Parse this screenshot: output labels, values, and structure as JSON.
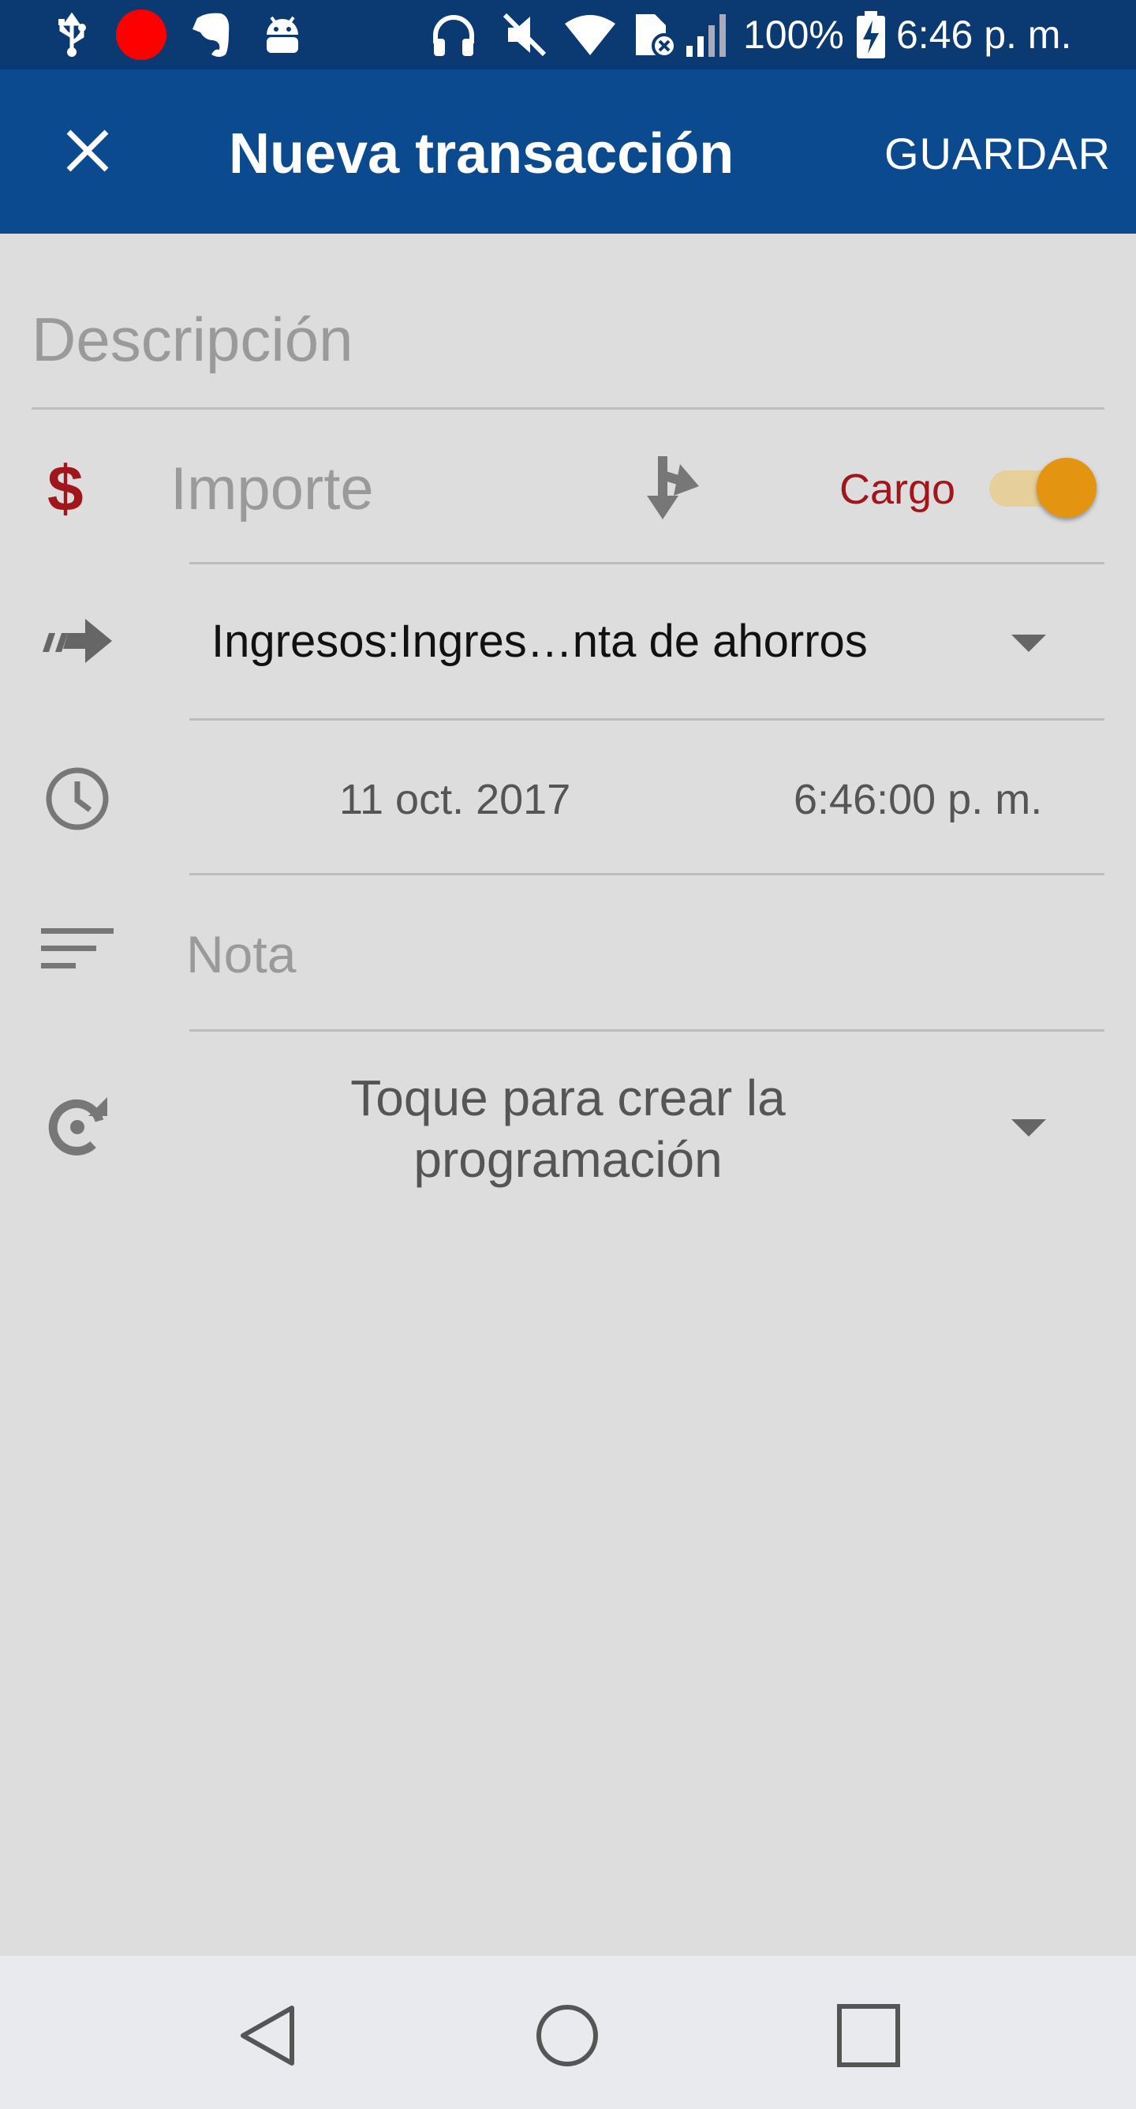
{
  "status_bar": {
    "battery": "100%",
    "time": "6:46 p. m.",
    "icons": [
      "usb-icon",
      "record-icon",
      "evernote-icon",
      "android-debug-icon",
      "headphones-icon",
      "mute-icon",
      "wifi-icon",
      "no-sim-icon",
      "signal-icon",
      "battery-charging-icon"
    ],
    "record_color": "#ff0000"
  },
  "app_bar": {
    "title": "Nueva transacción",
    "close_icon": "close-icon",
    "save_label": "GUARDAR",
    "background": "#0b4a8e"
  },
  "form": {
    "description_placeholder": "Descripción",
    "amount_symbol": "$",
    "amount_placeholder": "Importe",
    "transaction_type_label": "Cargo",
    "transaction_type_on": true,
    "account_value": "Ingresos:Ingres…nta de ahorros",
    "date_value": "11 oct. 2017",
    "time_value": "6:46:00 p. m.",
    "note_placeholder": "Nota",
    "schedule_value": "Toque para crear la programación",
    "accent_color": "#e39410",
    "debit_color": "#a0161a"
  },
  "nav_bar": {
    "icons": [
      "back-icon",
      "home-icon",
      "recents-icon"
    ]
  }
}
